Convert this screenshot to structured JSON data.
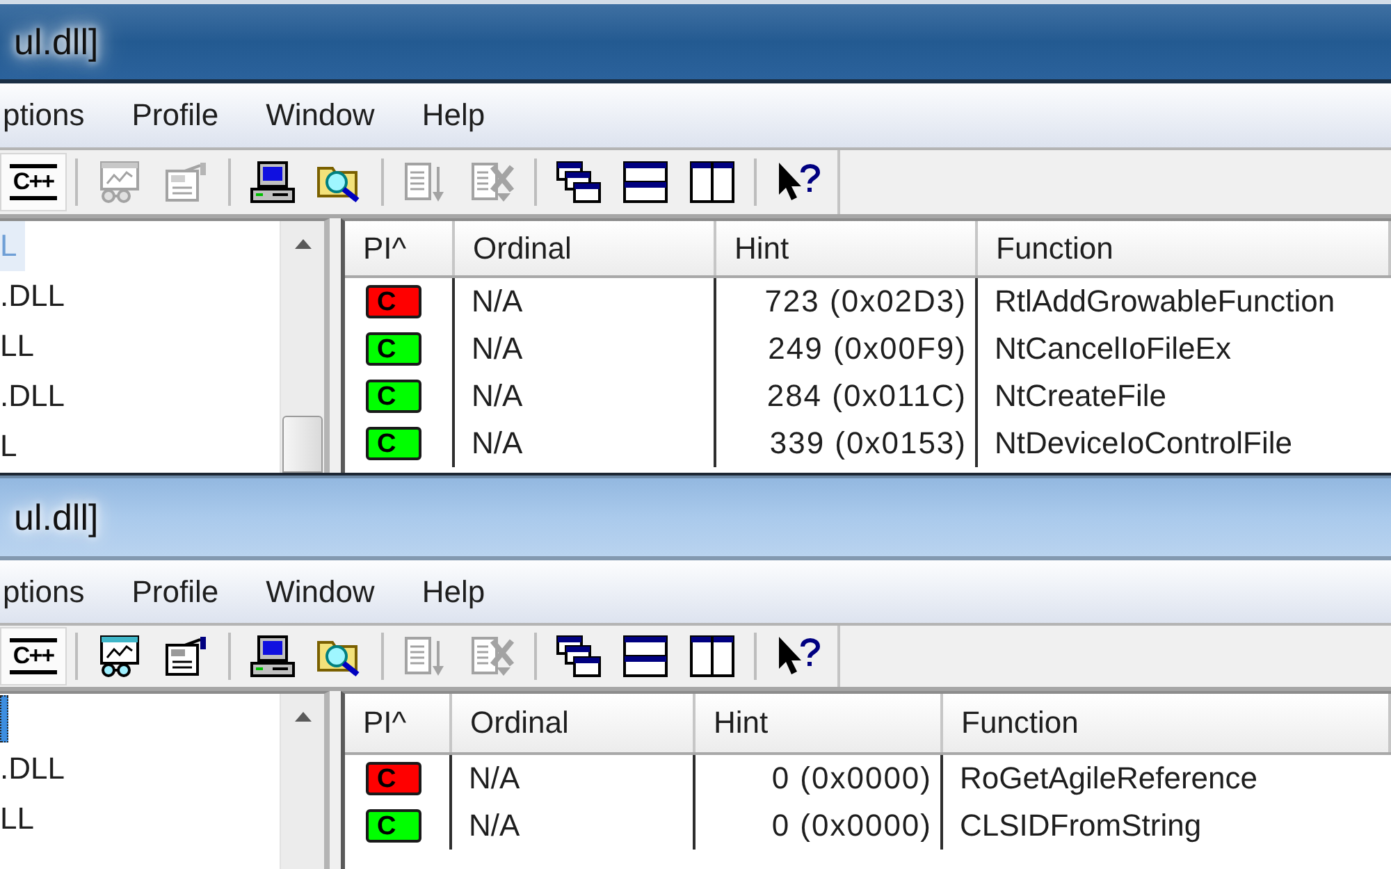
{
  "windows": [
    {
      "active": true,
      "title": "ul.dll]",
      "menu": [
        "ptions",
        "Profile",
        "Window",
        "Help"
      ],
      "toolbar": [
        {
          "kind": "cpp",
          "label": "C++",
          "pressed": true,
          "disabled": false
        },
        {
          "kind": "separator"
        },
        {
          "kind": "chart",
          "pressed": false,
          "disabled": true
        },
        {
          "kind": "properties",
          "pressed": false,
          "disabled": true
        },
        {
          "kind": "separator"
        },
        {
          "kind": "computer",
          "pressed": false,
          "disabled": false
        },
        {
          "kind": "folder_search",
          "pressed": false,
          "disabled": false
        },
        {
          "kind": "separator"
        },
        {
          "kind": "expand",
          "pressed": false,
          "disabled": true
        },
        {
          "kind": "collapse",
          "pressed": false,
          "disabled": true
        },
        {
          "kind": "separator"
        },
        {
          "kind": "cascade",
          "pressed": false,
          "disabled": false
        },
        {
          "kind": "tile_horizontal",
          "pressed": false,
          "disabled": false
        },
        {
          "kind": "tile_vertical",
          "pressed": false,
          "disabled": false
        },
        {
          "kind": "separator"
        },
        {
          "kind": "help",
          "pressed": false,
          "disabled": false
        }
      ],
      "tree": [
        {
          "label": "L",
          "selected": true
        },
        {
          "label": ".DLL",
          "selected": false
        },
        {
          "label": "LL",
          "selected": false
        },
        {
          "label": ".DLL",
          "selected": false
        },
        {
          "label": "L",
          "selected": false
        }
      ],
      "columns": [
        "PI^",
        "Ordinal",
        "Hint",
        "Function"
      ],
      "rows": [
        {
          "color": "#ff0000",
          "pi": "C",
          "ordinal": "N/A",
          "hint": "723 (0x02D3)",
          "function": "RtlAddGrowableFunction"
        },
        {
          "color": "#00ff00",
          "pi": "C",
          "ordinal": "N/A",
          "hint": "249 (0x00F9)",
          "function": "NtCancelIoFileEx"
        },
        {
          "color": "#00ff00",
          "pi": "C",
          "ordinal": "N/A",
          "hint": "284 (0x011C)",
          "function": "NtCreateFile"
        },
        {
          "color": "#00ff00",
          "pi": "C",
          "ordinal": "N/A",
          "hint": "339 (0x0153)",
          "function": "NtDeviceIoControlFile"
        }
      ]
    },
    {
      "active": false,
      "title": "ul.dll]",
      "menu": [
        "ptions",
        "Profile",
        "Window",
        "Help"
      ],
      "toolbar": [
        {
          "kind": "cpp",
          "label": "C++",
          "pressed": true,
          "disabled": false
        },
        {
          "kind": "separator"
        },
        {
          "kind": "chart",
          "pressed": false,
          "disabled": false
        },
        {
          "kind": "properties",
          "pressed": false,
          "disabled": false
        },
        {
          "kind": "separator"
        },
        {
          "kind": "computer",
          "pressed": false,
          "disabled": false
        },
        {
          "kind": "folder_search",
          "pressed": false,
          "disabled": false
        },
        {
          "kind": "separator"
        },
        {
          "kind": "expand",
          "pressed": false,
          "disabled": true
        },
        {
          "kind": "collapse",
          "pressed": false,
          "disabled": true
        },
        {
          "kind": "separator"
        },
        {
          "kind": "cascade",
          "pressed": false,
          "disabled": false
        },
        {
          "kind": "tile_horizontal",
          "pressed": false,
          "disabled": false
        },
        {
          "kind": "tile_vertical",
          "pressed": false,
          "disabled": false
        },
        {
          "kind": "separator"
        },
        {
          "kind": "help",
          "pressed": false,
          "disabled": false
        }
      ],
      "tree": [
        {
          "selected": true
        },
        {
          "label": ".DLL",
          "selected": false
        },
        {
          "label": "LL",
          "selected": false
        }
      ],
      "columns": [
        "PI^",
        "Ordinal",
        "Hint",
        "Function"
      ],
      "rows": [
        {
          "color": "#ff0000",
          "pi": "C",
          "ordinal": "N/A",
          "hint": "0 (0x0000)",
          "function": "RoGetAgileReference"
        },
        {
          "color": "#00ff00",
          "pi": "C",
          "ordinal": "N/A",
          "hint": "0 (0x0000)",
          "function": "CLSIDFromString"
        }
      ]
    }
  ]
}
